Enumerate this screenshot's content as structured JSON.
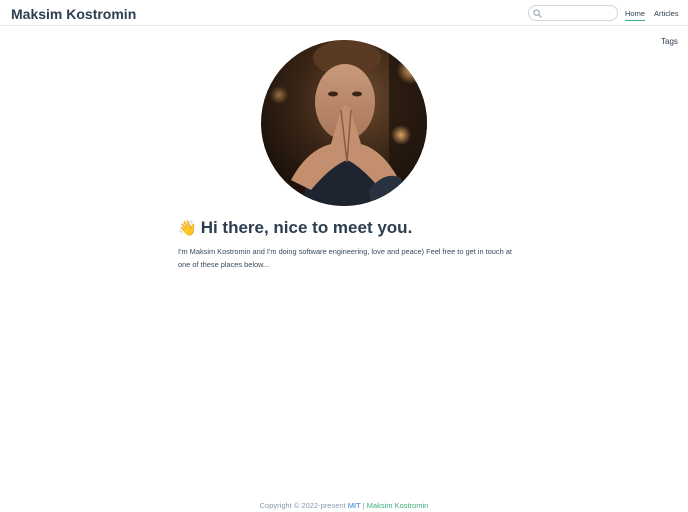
{
  "navbar": {
    "site_name": "Maksim Kostromin",
    "search": {
      "placeholder": "",
      "value": ""
    },
    "links": [
      {
        "label": "Home",
        "active": true
      },
      {
        "label": "Articles",
        "active": false
      }
    ],
    "tags_label": "Tags"
  },
  "main": {
    "avatar_icon": "profile-photo",
    "wave_emoji": "👋",
    "headline": "Hi there, nice to meet you.",
    "bio": "I'm Maksim Kostromin and I'm doing software engineering, love and peace) Feel free to get in touch at one of these places below..."
  },
  "footer": {
    "copyright": "Copyright © 2022-present",
    "license": "MIT",
    "separator": "|",
    "author": "Maksim Kostromin"
  },
  "colors": {
    "accent": "#3eaf7c",
    "text": "#2c3e50",
    "link_blue": "#2f7fd3"
  }
}
